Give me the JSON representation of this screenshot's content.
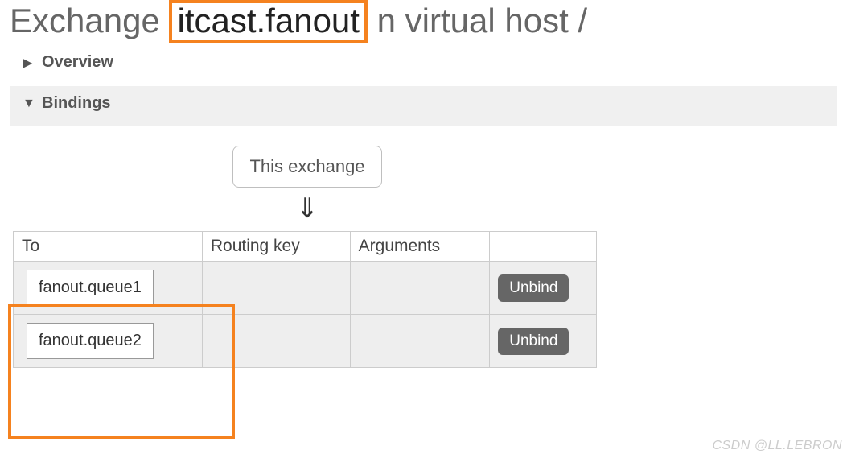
{
  "title": {
    "prefix": "Exchange",
    "name": "itcast.fanout",
    "middle": "n virtual host",
    "vhost": "/"
  },
  "sections": {
    "overview": {
      "label": "Overview",
      "collapsed": true
    },
    "bindings": {
      "label": "Bindings",
      "collapsed": false
    }
  },
  "bindings_panel": {
    "box_label": "This exchange",
    "arrow_glyph": "⇓",
    "columns": {
      "to": "To",
      "routing_key": "Routing key",
      "arguments": "Arguments"
    },
    "rows": [
      {
        "to": "fanout.queue1",
        "routing_key": "",
        "arguments": "",
        "unbind": "Unbind"
      },
      {
        "to": "fanout.queue2",
        "routing_key": "",
        "arguments": "",
        "unbind": "Unbind"
      }
    ]
  },
  "watermark": "CSDN @LL.LEBRON"
}
